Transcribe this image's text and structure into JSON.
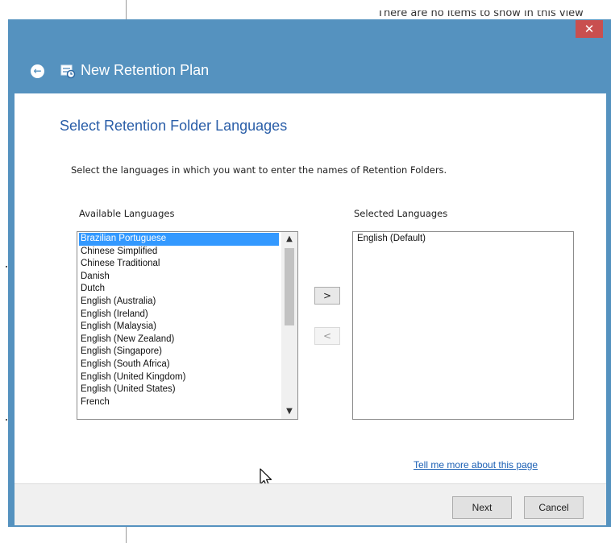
{
  "background": {
    "status_text": "There are no items to show in this view"
  },
  "dialog": {
    "title": "New Retention Plan",
    "close_glyph": "✕",
    "back_glyph": "←",
    "page_title": "Select Retention Folder Languages",
    "instructions": "Select the languages in which you want to enter the names of Retention Folders.",
    "available_label": "Available Languages",
    "selected_label": "Selected Languages",
    "available_languages": [
      "Brazilian Portuguese",
      "Chinese Simplified",
      "Chinese Traditional",
      "Danish",
      "Dutch",
      "English (Australia)",
      "English (Ireland)",
      "English (Malaysia)",
      "English (New Zealand)",
      "English (Singapore)",
      "English (South Africa)",
      "English (United Kingdom)",
      "English (United States)",
      "French"
    ],
    "selected_available": "Brazilian Portuguese",
    "selected_languages": [
      "English (Default)"
    ],
    "add_button": ">",
    "remove_button": "<",
    "help_link": "Tell me more about this page",
    "next_button": "Next",
    "cancel_button": "Cancel"
  },
  "colors": {
    "header_blue": "#5592bf",
    "selection_blue": "#3399ff",
    "title_blue": "#2a5ea8",
    "close_red": "#c94f4f"
  },
  "icons": {
    "back": "back-arrow-icon",
    "app": "retention-plan-icon",
    "close": "close-icon",
    "scroll_up": "chevron-up-icon",
    "scroll_down": "chevron-down-icon",
    "cursor": "mouse-cursor-icon"
  }
}
